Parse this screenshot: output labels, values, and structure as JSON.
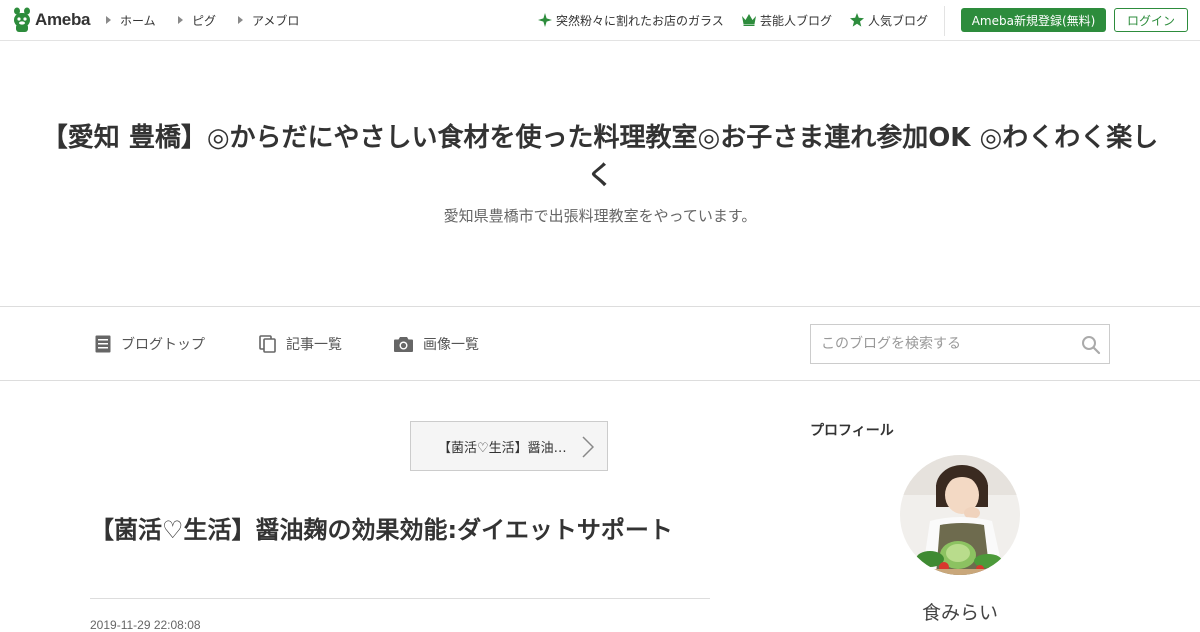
{
  "topbar": {
    "logo_text": "Ameba",
    "nav": [
      {
        "label": "ホーム"
      },
      {
        "label": "ピグ"
      },
      {
        "label": "アメブロ"
      }
    ],
    "right_links": [
      {
        "label": "突然粉々に割れたお店のガラス",
        "icon": "sparkle-icon"
      },
      {
        "label": "芸能人ブログ",
        "icon": "crown-icon"
      },
      {
        "label": "人気ブログ",
        "icon": "star-icon"
      }
    ],
    "register_label": "Ameba新規登録(無料)",
    "login_label": "ログイン"
  },
  "blog": {
    "title": "【愛知 豊橋】◎からだにやさしい食材を使った料理教室◎お子さま連れ参加OK ◎わくわく楽しく",
    "description": "愛知県豊橋市で出張料理教室をやっています。"
  },
  "blog_nav": {
    "items": [
      {
        "label": "ブログトップ",
        "icon": "document-icon"
      },
      {
        "label": "記事一覧",
        "icon": "copy-icon"
      },
      {
        "label": "画像一覧",
        "icon": "camera-icon"
      }
    ],
    "search_placeholder": "このブログを検索する"
  },
  "article": {
    "pager_label": "【菌活♡生活】醤油…",
    "title": "【菌活♡生活】醤油麹の効果効能:ダイエットサポート",
    "date": "2019-11-29 22:08:08"
  },
  "sidebar": {
    "profile_heading": "プロフィール",
    "profile_name": "食みらい"
  },
  "colors": {
    "brand_green": "#2d8c3c",
    "text": "#333333",
    "border": "#dddddd"
  }
}
